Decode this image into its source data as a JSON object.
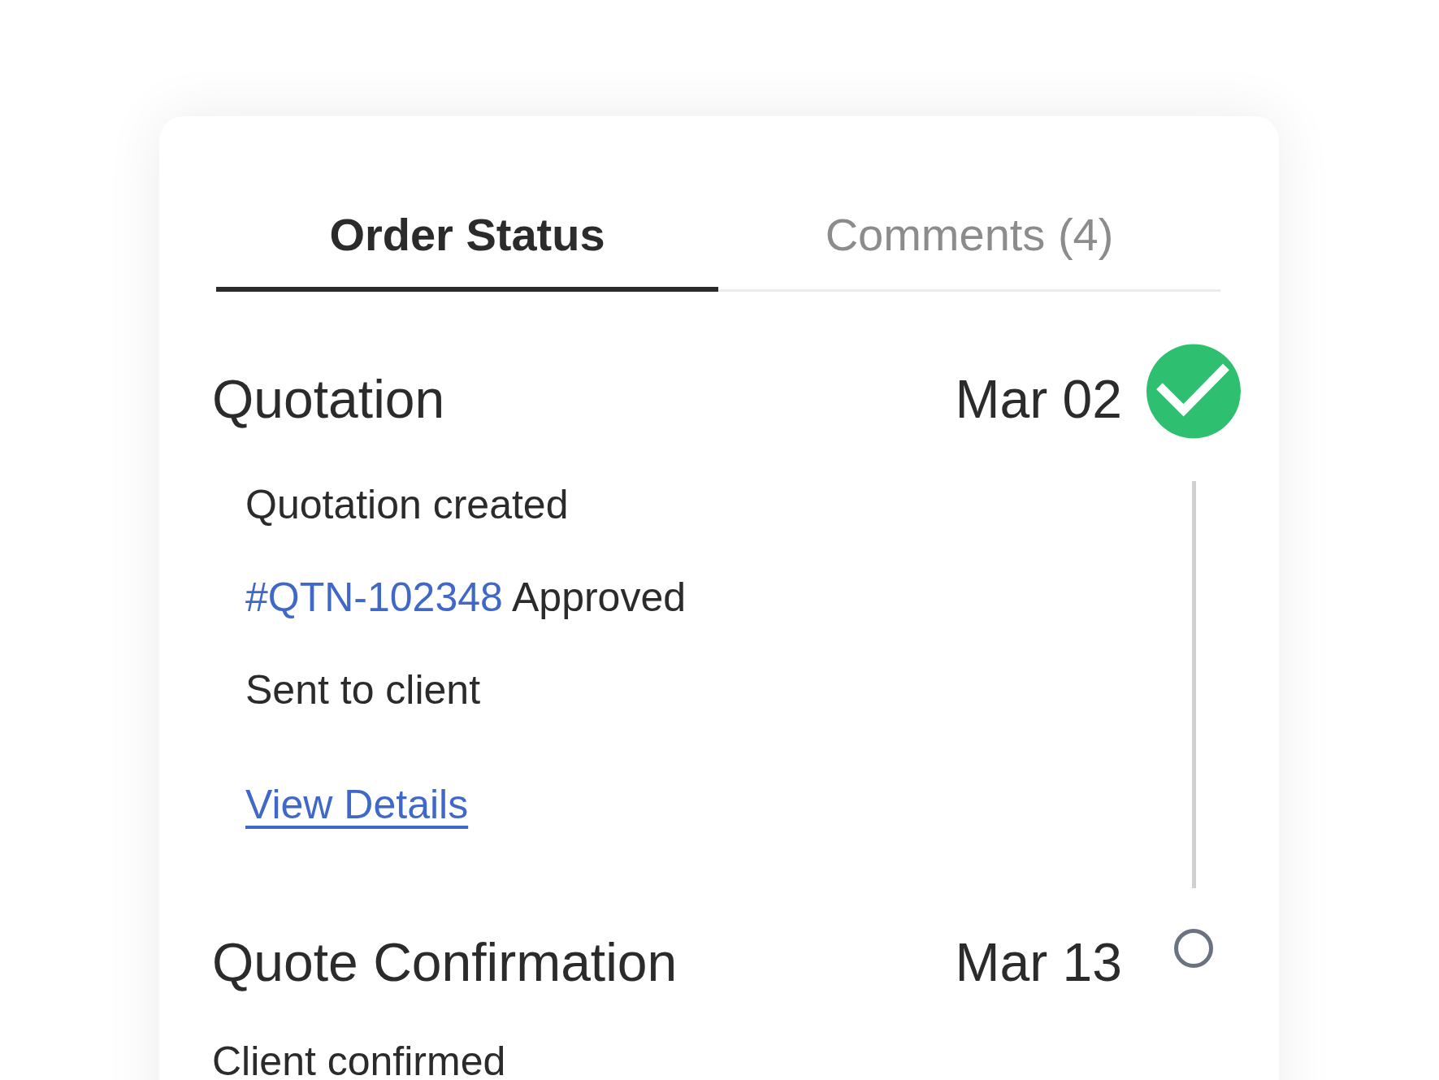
{
  "tabs": [
    {
      "label": "Order Status",
      "selected": true
    },
    {
      "label": "Comments (4)",
      "selected": false
    }
  ],
  "stages": [
    {
      "title": "Quotation",
      "date": "Mar 02",
      "completed": true,
      "events": [
        {
          "text": "Quotation created"
        },
        {
          "ref": "#QTN-102348",
          "text": "Approved"
        },
        {
          "text": "Sent to client"
        }
      ],
      "link": "View Details"
    },
    {
      "title": "Quote Confirmation",
      "date": "Mar 13",
      "completed": false,
      "note": "Client confirmed"
    }
  ]
}
